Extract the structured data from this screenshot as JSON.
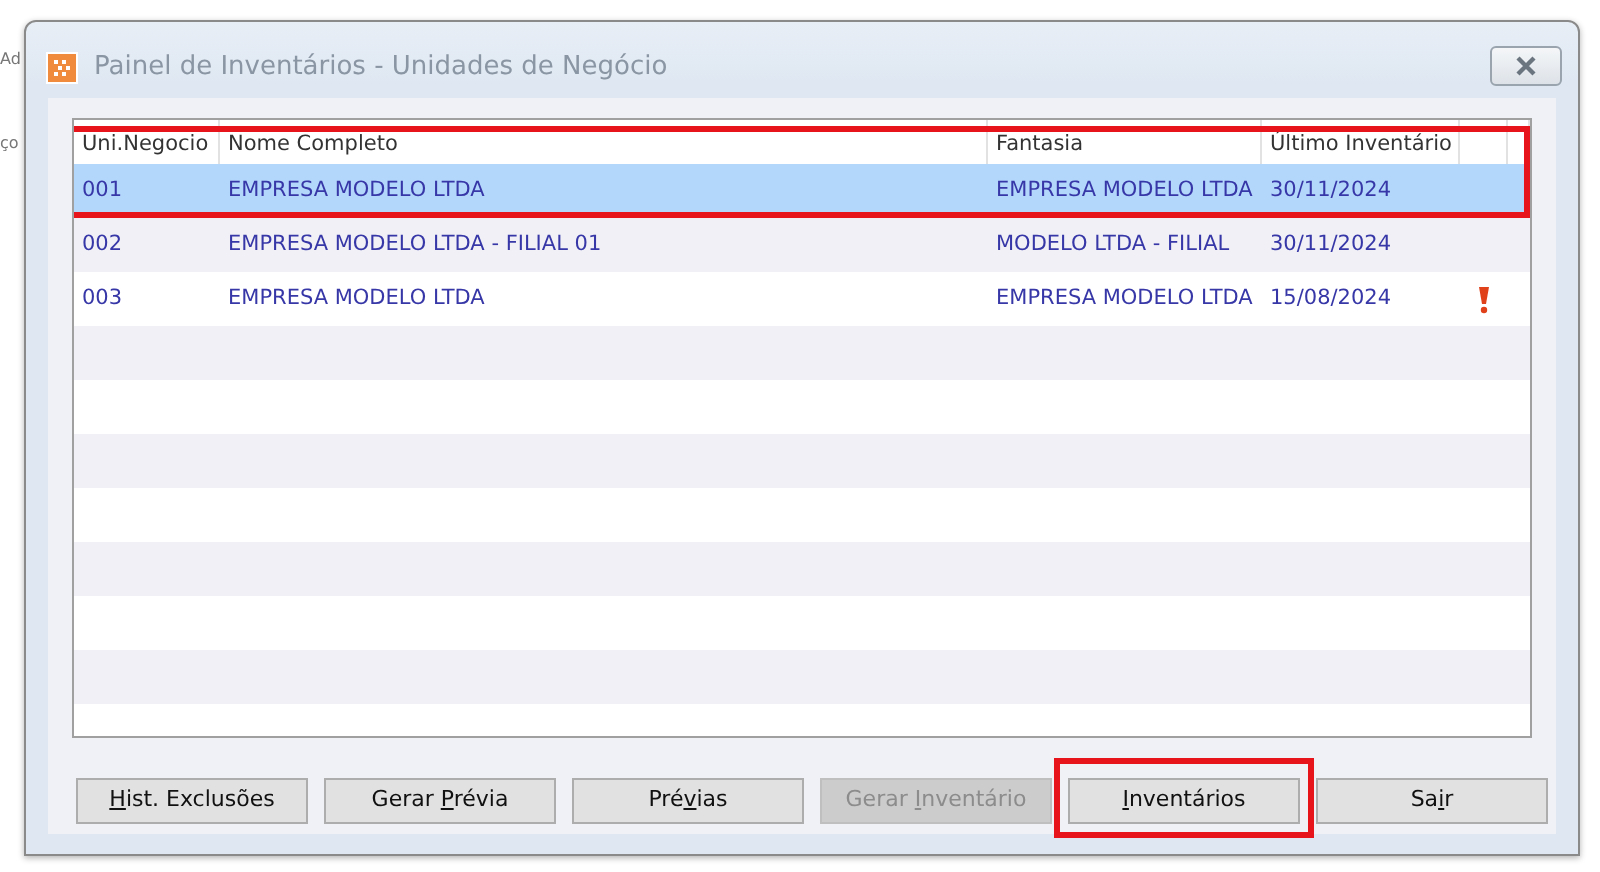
{
  "background_texts": [
    "Ad",
    "ço"
  ],
  "window": {
    "title": "Painel de Inventários - Unidades de Negócio"
  },
  "table": {
    "columns": [
      "Uni.Negocio",
      "Nome Completo",
      "Fantasia",
      "Último Inventário"
    ],
    "rows": [
      {
        "cells": [
          "001",
          "EMPRESA MODELO LTDA",
          "EMPRESA MODELO LTDA",
          "30/11/2024"
        ],
        "selected": true,
        "alert": false,
        "outlined": true
      },
      {
        "cells": [
          "002",
          "EMPRESA MODELO LTDA - FILIAL 01",
          "MODELO LTDA - FILIAL",
          "30/11/2024"
        ],
        "selected": false,
        "alert": false,
        "outlined": false
      },
      {
        "cells": [
          "003",
          "EMPRESA MODELO LTDA",
          "EMPRESA MODELO LTDA",
          "15/08/2024"
        ],
        "selected": false,
        "alert": true,
        "outlined": false
      }
    ]
  },
  "buttons": [
    {
      "key": "H",
      "after": "ist. Exclusões",
      "disabled": false,
      "outlined": false
    },
    {
      "before": "Gerar ",
      "key": "P",
      "after": "révia",
      "disabled": false,
      "outlined": false
    },
    {
      "before": "Pré",
      "key": "v",
      "after": "ias",
      "disabled": false,
      "outlined": false
    },
    {
      "before": "Gerar ",
      "key": "I",
      "after": "nventário",
      "disabled": true,
      "outlined": false
    },
    {
      "key": "I",
      "after": "nventários",
      "disabled": false,
      "outlined": true
    },
    {
      "before": "Sa",
      "key": "i",
      "after": "r",
      "disabled": false,
      "outlined": false
    }
  ]
}
